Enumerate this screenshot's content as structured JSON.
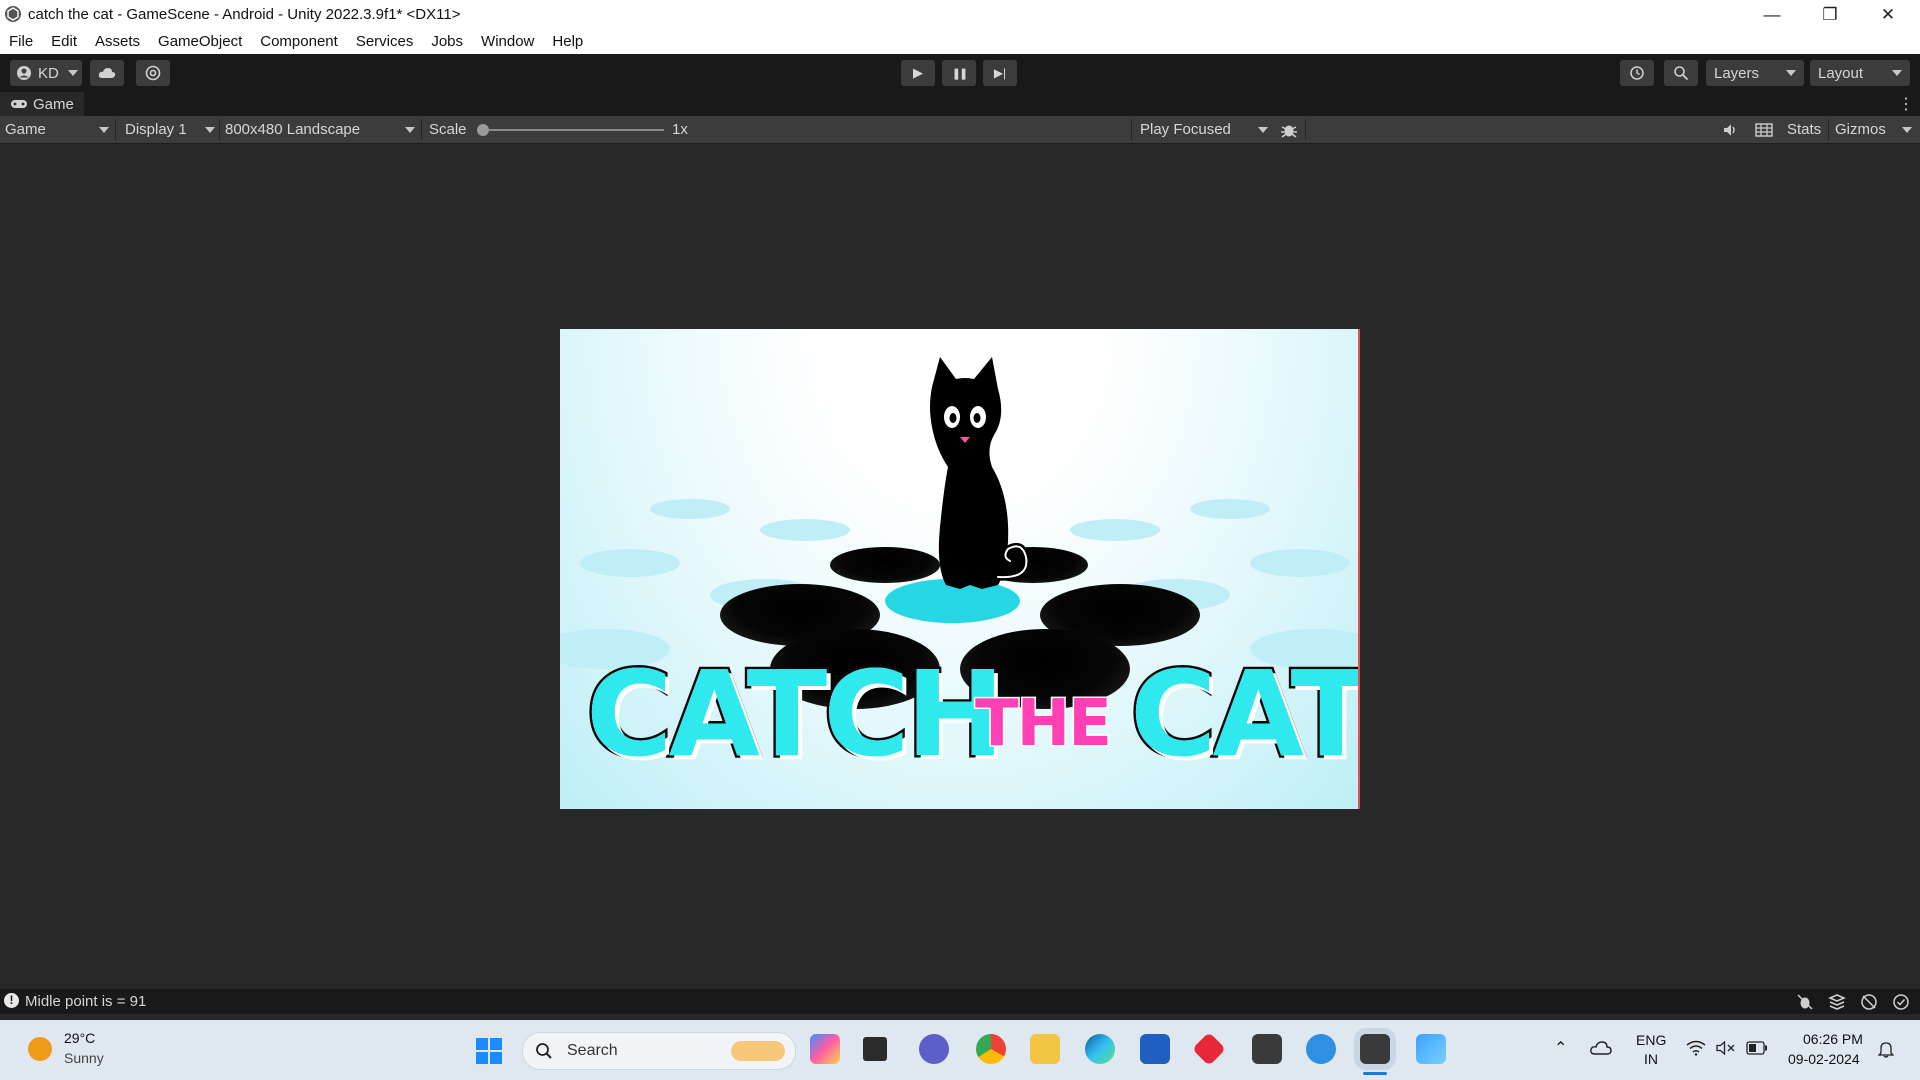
{
  "window": {
    "title": "catch the cat - GameScene - Android - Unity 2022.3.9f1* <DX11>",
    "controls": {
      "minimize": "—",
      "restore": "❐",
      "close": "✕"
    }
  },
  "menu": [
    "File",
    "Edit",
    "Assets",
    "GameObject",
    "Component",
    "Services",
    "Jobs",
    "Window",
    "Help"
  ],
  "toolbar": {
    "account": "KD",
    "play_icon": "▶",
    "pause_icon": "❚❚",
    "step_icon": "▶|",
    "layers": "Layers",
    "layout": "Layout"
  },
  "tab": {
    "label": "Game",
    "more": "⋮"
  },
  "gamebar": {
    "view_mode": "Game",
    "display": "Display 1",
    "resolution": "800x480 Landscape",
    "scale_label": "Scale",
    "scale_value": "1x",
    "play_mode": "Play Focused",
    "stats": "Stats",
    "gizmos": "Gizmos"
  },
  "game": {
    "title_word1": "CATCH",
    "title_word2": "THE",
    "title_word3": "CAT",
    "colors": {
      "cyan": "#2fe9ef",
      "pink": "#ff3fb4",
      "cat": "#000000"
    }
  },
  "status": {
    "message": "Midle point is = 91"
  },
  "taskbar": {
    "weather_temp": "29°C",
    "weather_cond": "Sunny",
    "search": "Search",
    "lang_top": "ENG",
    "lang_bottom": "IN",
    "time": "06:26 PM",
    "date": "09-02-2024"
  }
}
